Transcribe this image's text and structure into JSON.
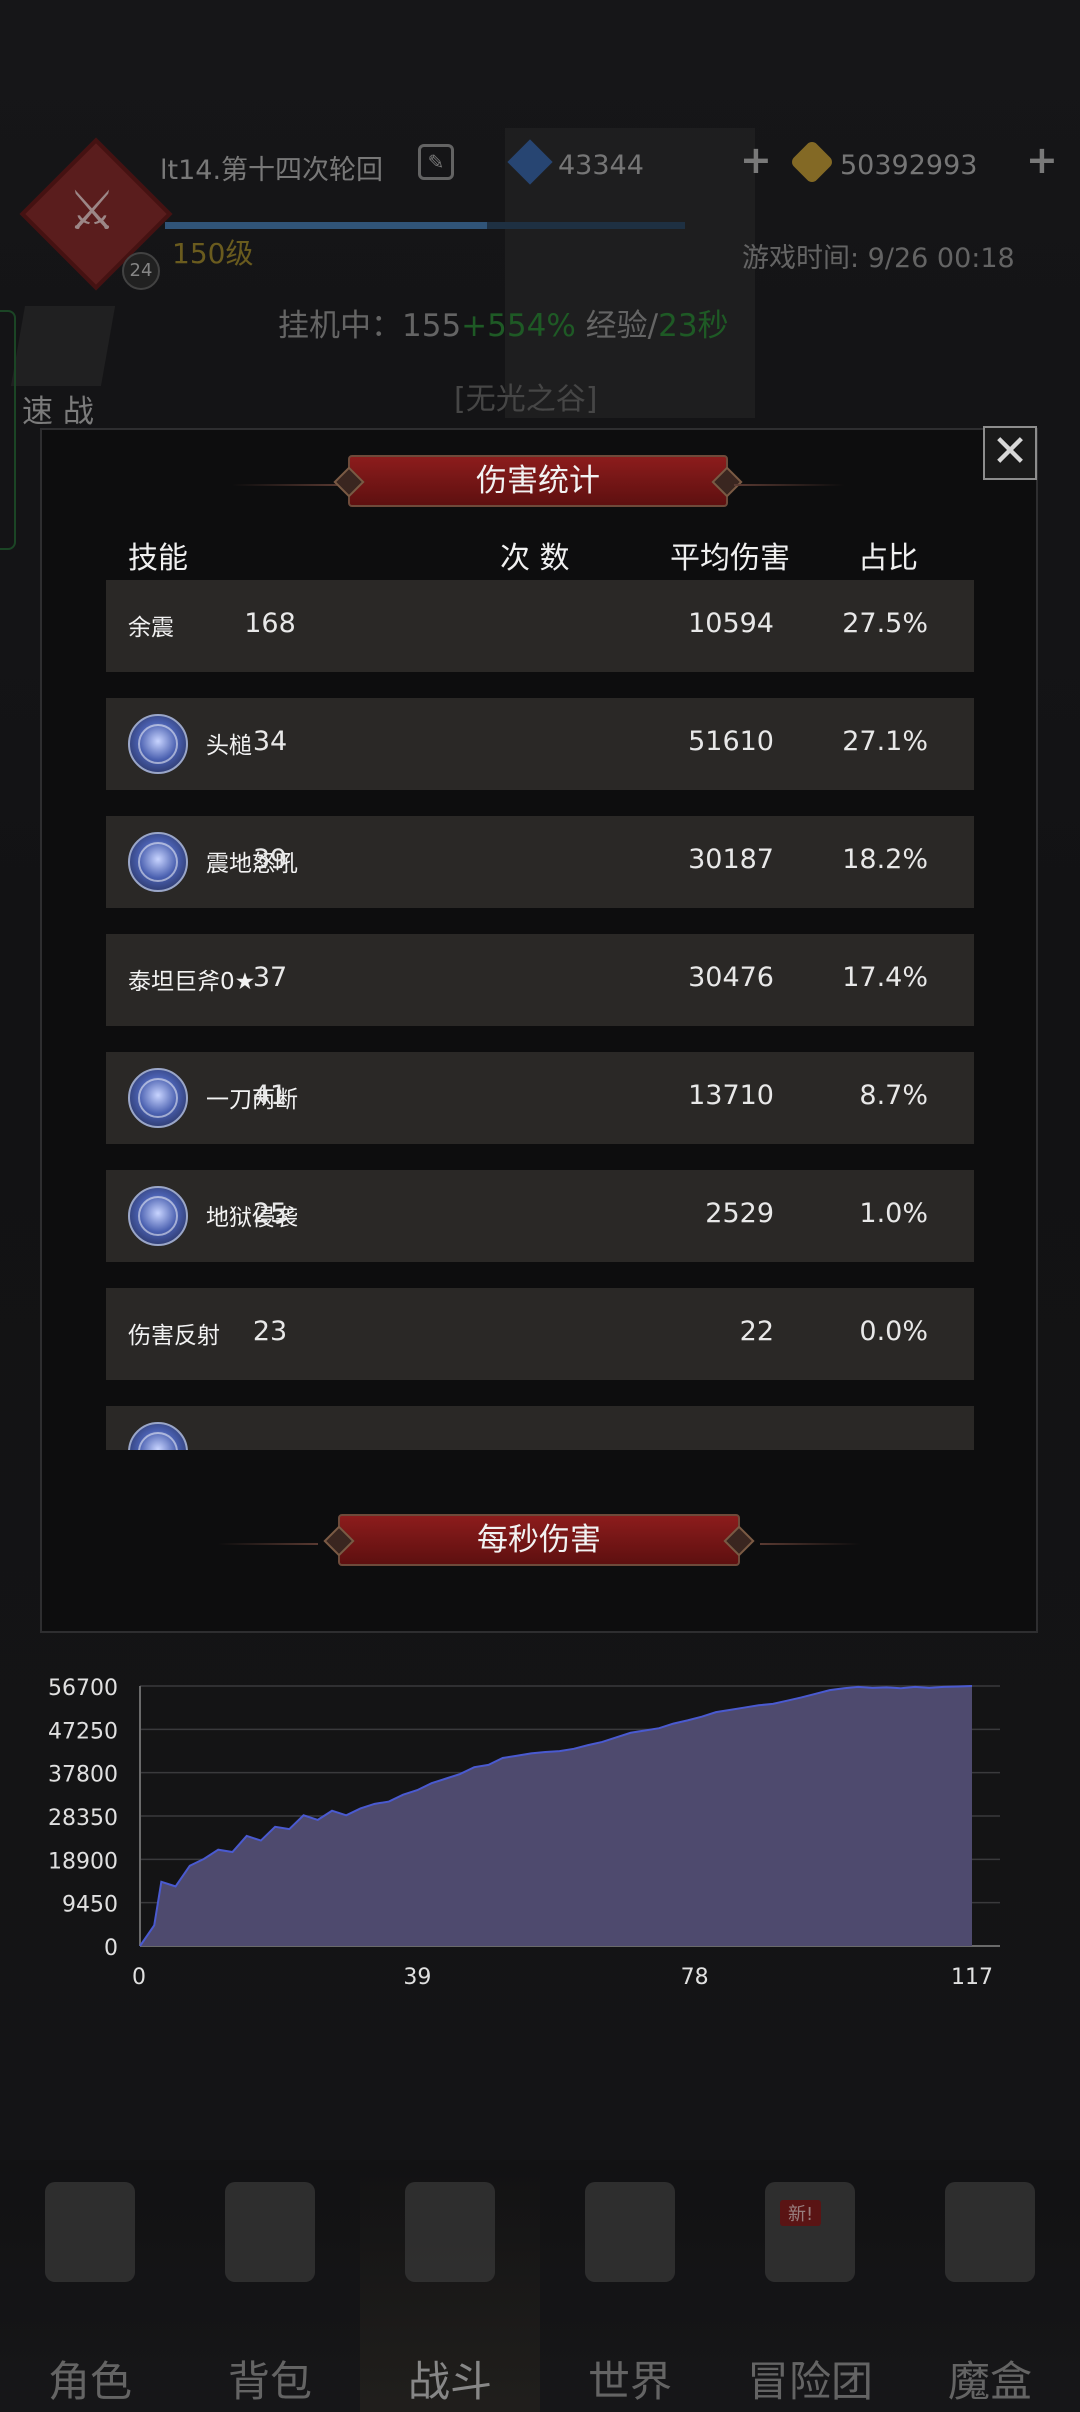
{
  "header": {
    "player_name": "lt14.第十四次轮回",
    "level": "150级",
    "avatar_badge": "24",
    "gems": "43344",
    "gold": "50392993",
    "game_time": "游戏时间: 9/26 00:18",
    "idle_prefix": "挂机中：155",
    "idle_bonus": "+554%",
    "idle_exp": " 经验/",
    "idle_rate": "23秒",
    "quick_battle": "速 战",
    "location": "[无光之谷]"
  },
  "modal": {
    "title": "伤害统计",
    "close": "✕",
    "columns": {
      "skill": "技能",
      "count": "次 数",
      "avg": "平均伤害",
      "pct": "占比"
    },
    "rows": [
      {
        "name": "余震",
        "icon": false,
        "count": "168",
        "avg": "10594",
        "pct": "27.5%"
      },
      {
        "name": "头槌",
        "icon": true,
        "count": "34",
        "avg": "51610",
        "pct": "27.1%"
      },
      {
        "name": "震地怒吼",
        "icon": true,
        "count": "39",
        "avg": "30187",
        "pct": "18.2%"
      },
      {
        "name": "泰坦巨斧0★",
        "icon": false,
        "count": "37",
        "avg": "30476",
        "pct": "17.4%"
      },
      {
        "name": "一刀两断",
        "icon": true,
        "count": "41",
        "avg": "13710",
        "pct": "8.7%"
      },
      {
        "name": "地狱侵袭",
        "icon": true,
        "count": "25",
        "avg": "2529",
        "pct": "1.0%"
      },
      {
        "name": "伤害反射",
        "icon": false,
        "count": "23",
        "avg": "22",
        "pct": "0.0%"
      },
      {
        "name": "",
        "icon": true,
        "count": "",
        "avg": "",
        "pct": ""
      }
    ],
    "dps_title": "每秒伤害"
  },
  "chart_data": {
    "type": "area",
    "title": "每秒伤害",
    "xlabel": "",
    "ylabel": "",
    "xlim": [
      0,
      117
    ],
    "ylim": [
      0,
      56700
    ],
    "xticks": [
      0,
      39,
      78,
      117
    ],
    "yticks": [
      0,
      9450,
      18900,
      28350,
      37800,
      47250,
      56700
    ],
    "grid": true,
    "x": [
      0,
      2,
      3,
      5,
      7,
      9,
      11,
      13,
      15,
      17,
      19,
      21,
      23,
      25,
      27,
      29,
      31,
      33,
      35,
      37,
      39,
      41,
      43,
      45,
      47,
      49,
      51,
      53,
      55,
      57,
      59,
      61,
      63,
      65,
      67,
      69,
      71,
      73,
      75,
      77,
      79,
      81,
      83,
      85,
      87,
      89,
      91,
      93,
      95,
      97,
      99,
      101,
      103,
      105,
      107,
      109,
      111,
      113,
      115,
      117
    ],
    "y": [
      0,
      4500,
      14000,
      13000,
      17500,
      19000,
      21000,
      20500,
      24000,
      23000,
      26000,
      25500,
      28500,
      27500,
      29500,
      28500,
      30000,
      31000,
      31500,
      33000,
      34000,
      35500,
      36500,
      37500,
      39000,
      39500,
      41000,
      41500,
      42000,
      42300,
      42500,
      43000,
      43800,
      44500,
      45500,
      46500,
      47000,
      47500,
      48500,
      49200,
      50000,
      51000,
      51500,
      52000,
      52500,
      52800,
      53500,
      54200,
      55000,
      55800,
      56200,
      56500,
      56300,
      56400,
      56200,
      56500,
      56300,
      56500,
      56600,
      56700
    ],
    "fill_color": "#4e4a6e",
    "line_color": "#4a5ad0"
  },
  "bottom_nav": [
    {
      "label": "角色",
      "active": false,
      "badge": ""
    },
    {
      "label": "背包",
      "active": false,
      "badge": ""
    },
    {
      "label": "战斗",
      "active": true,
      "badge": ""
    },
    {
      "label": "世界",
      "active": false,
      "badge": ""
    },
    {
      "label": "冒险团",
      "active": false,
      "badge": "新!"
    },
    {
      "label": "魔盒",
      "active": false,
      "badge": ""
    }
  ]
}
